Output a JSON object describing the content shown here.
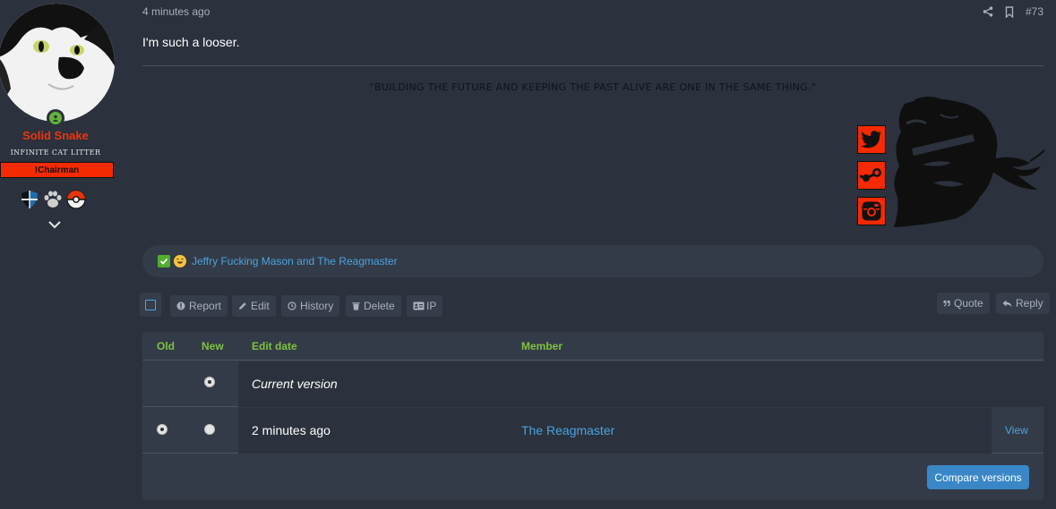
{
  "user": {
    "name": "Solid Snake",
    "title": "INFINITE CAT LITTER",
    "banner": "Chairman",
    "banner_prefix": "!",
    "trophies": [
      "shield-icon",
      "paw-icon",
      "pokeball-icon"
    ]
  },
  "post": {
    "date": "4 minutes ago",
    "number": "#73",
    "body": "I'm such a looser.",
    "signature_quote": "\"BUILDING THE FUTURE AND KEEPING THE PAST ALIVE ARE ONE IN THE SAME THING.\"",
    "social_icons": [
      "twitter-icon",
      "steam-icon",
      "instagram-icon"
    ]
  },
  "reactions": {
    "names": "Jeffry Fucking Mason and The Reagmaster"
  },
  "toolbar": {
    "report": "Report",
    "edit": "Edit",
    "history": "History",
    "delete": "Delete",
    "ip": "IP",
    "quote": "Quote",
    "reply": "Reply"
  },
  "history": {
    "columns": {
      "old": "Old",
      "new": "New",
      "edit_date": "Edit date",
      "member": "Member"
    },
    "rows": [
      {
        "edit_date": "Current version",
        "member": "",
        "old_radio": false,
        "new_radio": true,
        "new_checked": true
      },
      {
        "edit_date": "2 minutes ago",
        "member": "The Reagmaster",
        "old_radio": true,
        "old_checked": true,
        "new_radio": true,
        "new_checked": false,
        "view": "View"
      }
    ],
    "compare_button": "Compare versions"
  },
  "colors": {
    "background": "#2b313d",
    "accent_red": "#f42a03",
    "link_blue": "#4aa3df",
    "header_green": "#7ec23e",
    "button_blue": "#3a87c7"
  }
}
